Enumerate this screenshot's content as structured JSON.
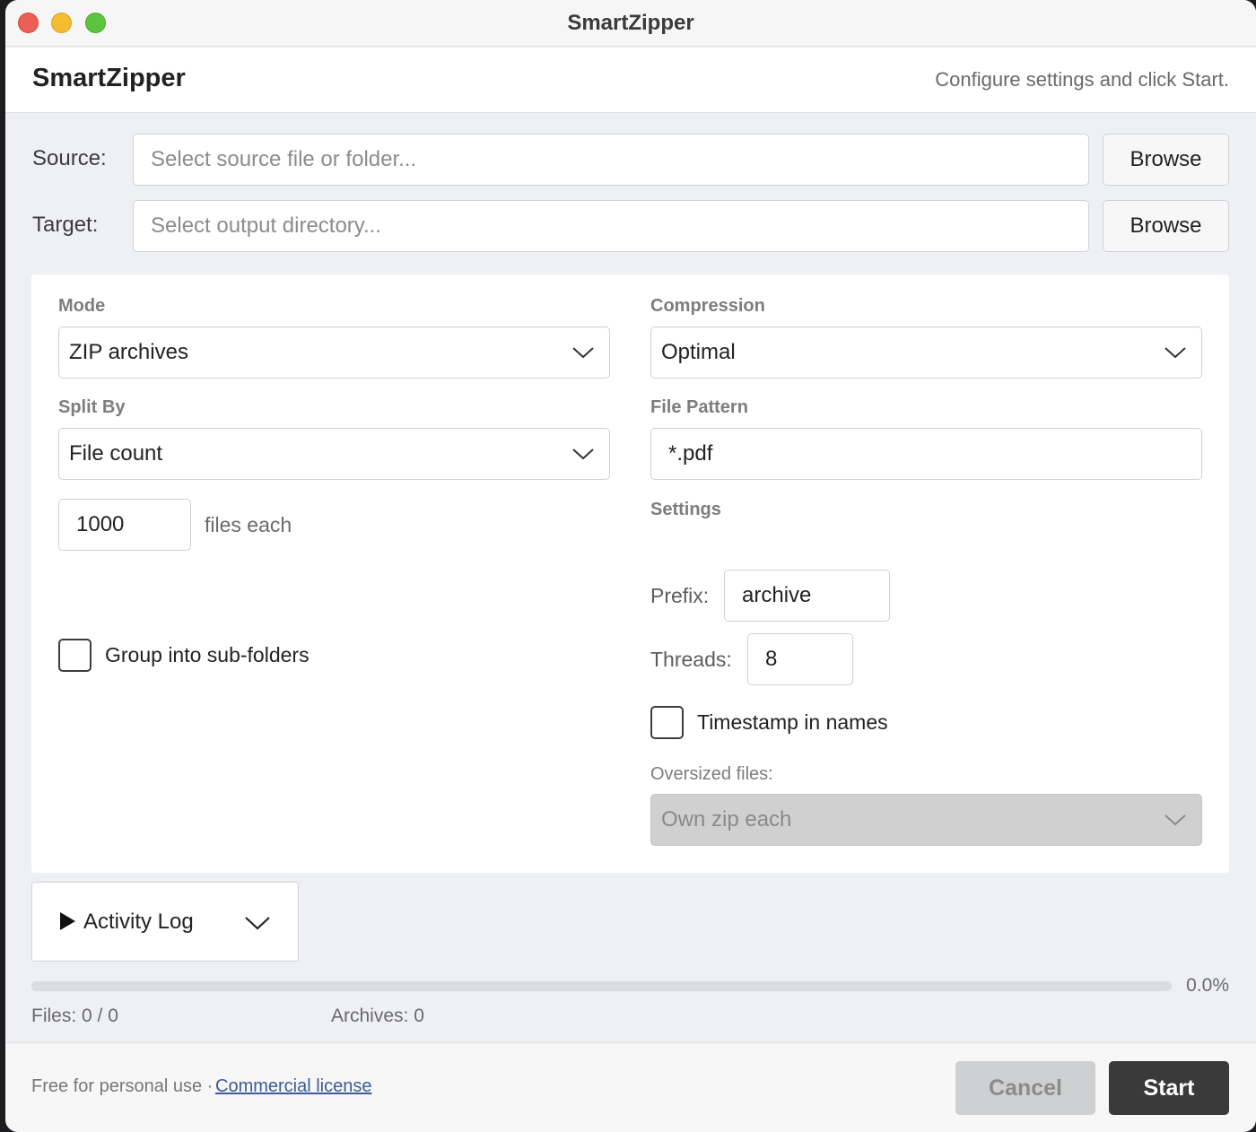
{
  "window": {
    "title": "SmartZipper"
  },
  "header": {
    "title": "SmartZipper",
    "status": "Configure settings and click Start."
  },
  "source": {
    "label": "Source:",
    "placeholder": "Select source file or folder...",
    "browse": "Browse"
  },
  "target": {
    "label": "Target:",
    "placeholder": "Select output directory...",
    "browse": "Browse"
  },
  "mode": {
    "label": "Mode",
    "value": "ZIP archives"
  },
  "compression": {
    "label": "Compression",
    "value": "Optimal"
  },
  "split_by": {
    "label": "Split By",
    "value": "File count"
  },
  "file_pattern": {
    "label": "File Pattern",
    "value": "*.pdf"
  },
  "count": {
    "value": "1000",
    "suffix": "files each"
  },
  "settings": {
    "label": "Settings",
    "prefix_label": "Prefix:",
    "prefix_value": "archive",
    "threads_label": "Threads:",
    "threads_value": "8",
    "timestamp_label": "Timestamp in names"
  },
  "group_subfolders": {
    "label": "Group into sub-folders"
  },
  "oversized": {
    "label": "Oversized files:",
    "value": "Own zip each"
  },
  "activity_log": {
    "label": "Activity Log"
  },
  "progress": {
    "fraction": 0.0,
    "text": "0.0%"
  },
  "stats": {
    "files": "Files: 0 / 0",
    "archives": "Archives: 0"
  },
  "footer": {
    "note": "Free for personal use ·",
    "link": "Commercial license",
    "cancel": "Cancel",
    "start": "Start"
  },
  "icons": {
    "dropdown": "chevron-down-icon",
    "log_toggle": "play-triangle-icon"
  },
  "colors": {
    "primary_button": "#3a3a3a",
    "link": "#3c5a99",
    "close": "#ec5f57",
    "minimize": "#f4bd30",
    "zoom": "#5dc43e"
  }
}
